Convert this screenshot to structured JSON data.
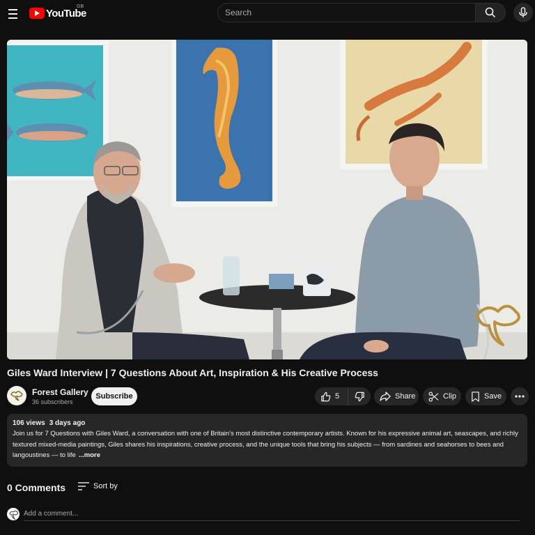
{
  "header": {
    "logo_text": "YouTube",
    "region": "GB",
    "search_placeholder": "Search",
    "icons": [
      "menu-icon",
      "youtube-logo",
      "search-icon",
      "microphone-icon"
    ]
  },
  "video": {
    "title": "Giles Ward Interview | 7 Questions About Art, Inspiration & His Creative Process",
    "player_logo": "forest-gallery-watermark"
  },
  "channel": {
    "name": "Forest Gallery",
    "subscribers": "36 subscribers",
    "subscribe_label": "Subscribe"
  },
  "actions": {
    "like_count": "5",
    "share_label": "Share",
    "clip_label": "Clip",
    "save_label": "Save"
  },
  "description": {
    "views": "106 views",
    "date": "3 days ago",
    "text": "Join us for 7 Questions with Giles Ward, a conversation with one of Britain's most distinctive contemporary artists. Known for his expressive animal art, seascapes, and richly textured mixed-media paintings, Giles shares his inspirations, creative process, and the unique tools that bring his subjects — from sardines and seahorses to bees and langoustines — to life",
    "more_label": "...more"
  },
  "comments": {
    "count_label": "0 Comments",
    "sort_label": "Sort by",
    "input_placeholder": "Add a comment..."
  },
  "colors": {
    "background": "#0f0f0f",
    "surface": "#272727",
    "brand_red": "#ff0000",
    "text": "#f1f1f1",
    "muted": "#aaaaaa"
  }
}
